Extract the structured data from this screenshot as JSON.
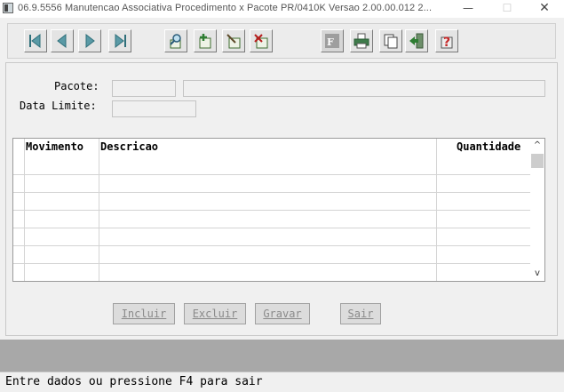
{
  "window": {
    "title": "06.9.5556 Manutencao Associativa Procedimento x Pacote PR/0410K Versao 2.00.00.012 2...",
    "min_glyph": "—",
    "max_glyph": "☐",
    "close_glyph": "✕"
  },
  "toolbar": {
    "buttons": [
      {
        "icon": "first-record-icon"
      },
      {
        "icon": "previous-record-icon"
      },
      {
        "icon": "next-record-icon"
      },
      {
        "icon": "last-record-icon"
      },
      {
        "icon": "search-icon"
      },
      {
        "icon": "add-record-icon"
      },
      {
        "icon": "edit-record-icon"
      },
      {
        "icon": "delete-record-icon"
      },
      {
        "icon": "filter-icon"
      },
      {
        "icon": "print-icon"
      },
      {
        "icon": "copy-icon"
      },
      {
        "icon": "exit-icon"
      },
      {
        "icon": "help-icon"
      }
    ]
  },
  "form": {
    "pacote_label": "Pacote:",
    "pacote_code_value": "",
    "pacote_desc_value": "",
    "data_limite_label": "Data Limite:",
    "data_limite_value": ""
  },
  "grid": {
    "columns": [
      "Movimento",
      "Descricao",
      "Quantidade"
    ],
    "rows": [
      {
        "movimento": "",
        "descricao": "",
        "quantidade": ""
      },
      {
        "movimento": "",
        "descricao": "",
        "quantidade": ""
      },
      {
        "movimento": "",
        "descricao": "",
        "quantidade": ""
      },
      {
        "movimento": "",
        "descricao": "",
        "quantidade": ""
      },
      {
        "movimento": "",
        "descricao": "",
        "quantidade": ""
      },
      {
        "movimento": "",
        "descricao": "",
        "quantidade": ""
      }
    ],
    "scroll_up": "^",
    "scroll_down": "v"
  },
  "actions": {
    "incluir": "Incluir",
    "excluir": "Excluir",
    "gravar": "Gravar",
    "sair": "Sair"
  },
  "status": {
    "message": "Entre dados ou pressione F4 para sair"
  }
}
